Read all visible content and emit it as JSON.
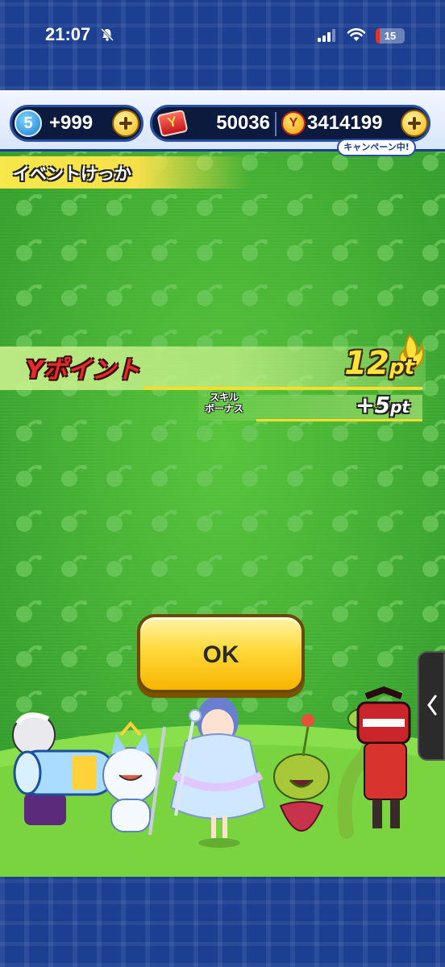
{
  "status_bar": {
    "time": "21:07",
    "battery_level": "15",
    "battery_fraction": 0.15,
    "icons": [
      "bell-slash-icon",
      "cellular-signal-icon",
      "wifi-icon",
      "battery-icon"
    ]
  },
  "resources": {
    "stamina_level": "5",
    "stamina_value": "+999",
    "ticket_icon_letter": "Y",
    "ticket_value": "50036",
    "money_icon_letter": "Y",
    "money_value": "3414199",
    "campaign_badge": "キャンペーン中!"
  },
  "event_header": {
    "title": "イベントけっか"
  },
  "points": {
    "ypoint_label": "Yポイント",
    "ypoint_value": "12",
    "ypoint_unit": "pt",
    "bonus_label_line1": "スキル",
    "bonus_label_line2": "ボーナス",
    "bonus_value": "+5",
    "bonus_unit": "pt"
  },
  "ok_button": {
    "label": "OK"
  },
  "colors": {
    "background_green": "#3fae35",
    "frame_blue": "#1d3f92",
    "gold": "#ffd93a",
    "red_accent": "#e52b2b"
  }
}
